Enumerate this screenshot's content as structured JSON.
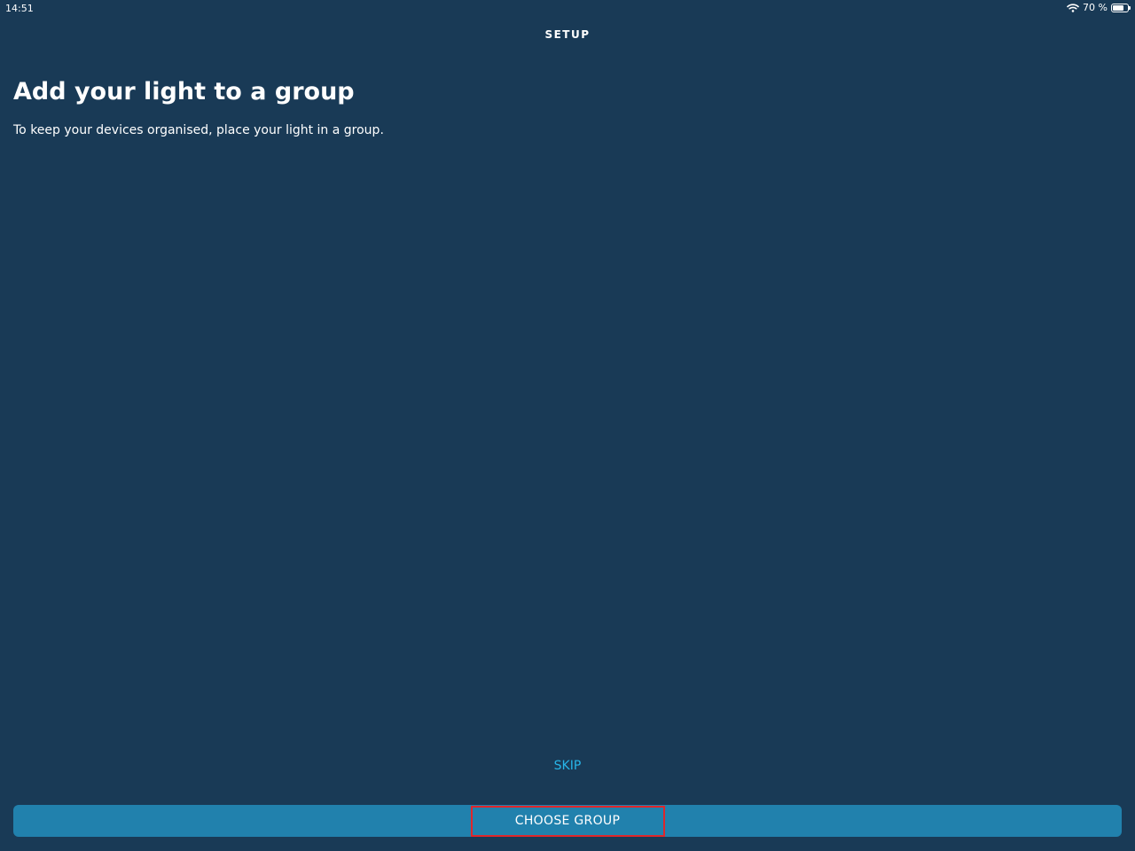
{
  "status_bar": {
    "time": "14:51",
    "battery_text": "70 %",
    "icons": [
      "wifi-icon",
      "battery-icon"
    ]
  },
  "header": {
    "title": "SETUP"
  },
  "main": {
    "title": "Add your light to a group",
    "subtitle": "To keep your devices organised, place your light in a group."
  },
  "actions": {
    "skip_label": "SKIP",
    "choose_group_label": "CHOOSE GROUP"
  },
  "colors": {
    "background": "#193a56",
    "primary_button": "#2181ad",
    "link": "#27b5e8",
    "highlight": "#e0262b"
  }
}
